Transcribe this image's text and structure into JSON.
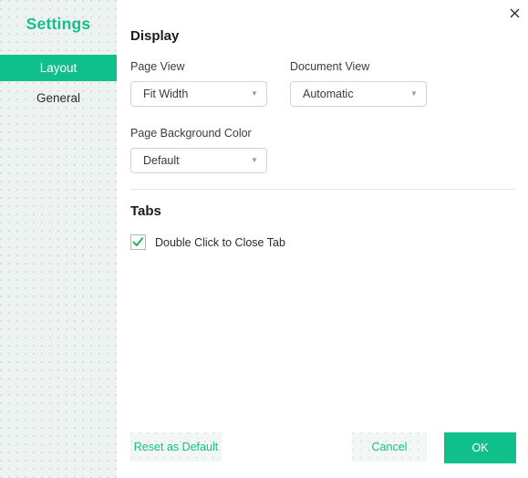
{
  "window": {
    "close_icon": "close-icon"
  },
  "sidebar": {
    "title": "Settings",
    "items": [
      {
        "label": "Layout",
        "active": true
      },
      {
        "label": "General",
        "active": false
      }
    ]
  },
  "main": {
    "sections": [
      {
        "title": "Display",
        "fields": [
          {
            "label": "Page View",
            "value": "Fit Width",
            "caret": "chevron-down-icon"
          },
          {
            "label": "Document View",
            "value": "Automatic",
            "caret": "chevron-down-icon"
          },
          {
            "label": "Page Background Color",
            "value": "Default",
            "caret": "chevron-down-icon"
          }
        ]
      },
      {
        "title": "Tabs",
        "checkbox": {
          "label": "Double Click to Close Tab",
          "checked": true,
          "check_icon": "check-icon"
        }
      }
    ]
  },
  "footer": {
    "reset_label": "Reset as Default",
    "cancel_label": "Cancel",
    "ok_label": "OK"
  },
  "colors": {
    "accent": "#0fc08a",
    "accent_text": "#12c08c",
    "sidebar_bg": "#eef3f1",
    "border": "#d4d4d4",
    "divider": "#e4e4e4",
    "check": "#1fae54"
  }
}
